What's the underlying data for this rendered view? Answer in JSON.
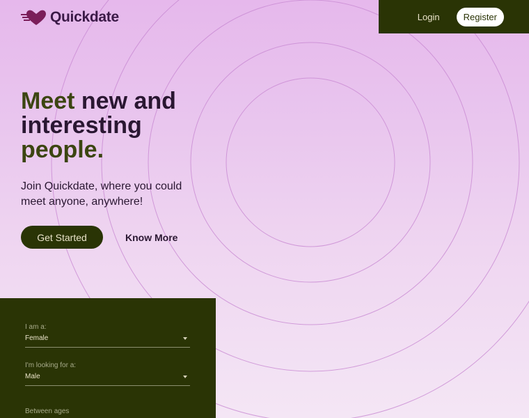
{
  "brand": {
    "name": "Quickdate",
    "logo_icon": "heart-speed-icon",
    "logo_color": "#7b1e5a"
  },
  "nav": {
    "login_label": "Login",
    "register_label": "Register"
  },
  "hero": {
    "title_accent_1": "Meet",
    "title_main": " new and interesting ",
    "title_accent_2": "people.",
    "subtitle": "Join Quickdate, where you could meet anyone, anywhere!",
    "primary_cta": "Get Started",
    "secondary_cta": "Know More"
  },
  "search_form": {
    "gender": {
      "label": "I am a:",
      "value": "Female"
    },
    "looking_for": {
      "label": "I'm looking for a:",
      "value": "Male"
    },
    "ages": {
      "label": "Between ages"
    }
  },
  "colors": {
    "dark_olive": "#2a3405",
    "plum_text": "#2a1732",
    "olive_accent": "#3c4511"
  }
}
